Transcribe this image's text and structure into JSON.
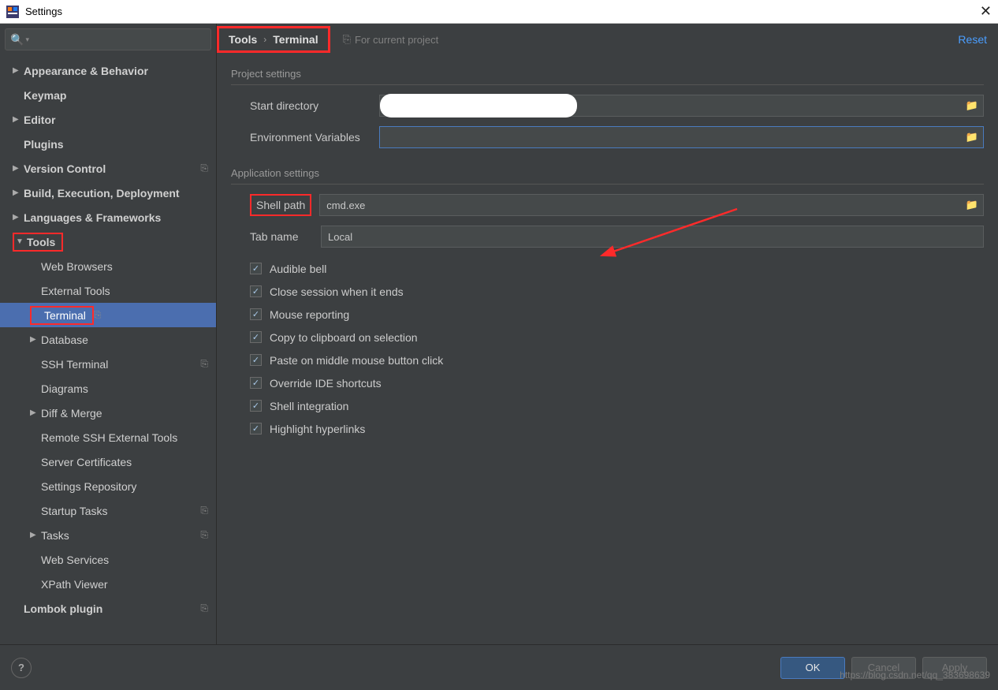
{
  "window": {
    "title": "Settings"
  },
  "breadcrumb": {
    "a": "Tools",
    "b": "Terminal",
    "hint": "For current project",
    "reset": "Reset"
  },
  "sidebar": {
    "items": [
      {
        "label": "Appearance & Behavior",
        "arrow": "▶",
        "bold": true,
        "level": 0
      },
      {
        "label": "Keymap",
        "arrow": "",
        "bold": true,
        "level": 0
      },
      {
        "label": "Editor",
        "arrow": "▶",
        "bold": true,
        "level": 0
      },
      {
        "label": "Plugins",
        "arrow": "",
        "bold": true,
        "level": 0
      },
      {
        "label": "Version Control",
        "arrow": "▶",
        "bold": true,
        "level": 0,
        "copy": true
      },
      {
        "label": "Build, Execution, Deployment",
        "arrow": "▶",
        "bold": true,
        "level": 0
      },
      {
        "label": "Languages & Frameworks",
        "arrow": "▶",
        "bold": true,
        "level": 0
      },
      {
        "label": "Tools",
        "arrow": "▼",
        "bold": true,
        "level": 0,
        "redbox": true
      },
      {
        "label": "Web Browsers",
        "arrow": "",
        "level": 1
      },
      {
        "label": "External Tools",
        "arrow": "",
        "level": 1
      },
      {
        "label": "Terminal",
        "arrow": "",
        "level": 1,
        "selected": true,
        "redbox": true,
        "copy": true
      },
      {
        "label": "Database",
        "arrow": "▶",
        "level": 1
      },
      {
        "label": "SSH Terminal",
        "arrow": "",
        "level": 1,
        "copy": true
      },
      {
        "label": "Diagrams",
        "arrow": "",
        "level": 1
      },
      {
        "label": "Diff & Merge",
        "arrow": "▶",
        "level": 1
      },
      {
        "label": "Remote SSH External Tools",
        "arrow": "",
        "level": 1
      },
      {
        "label": "Server Certificates",
        "arrow": "",
        "level": 1
      },
      {
        "label": "Settings Repository",
        "arrow": "",
        "level": 1
      },
      {
        "label": "Startup Tasks",
        "arrow": "",
        "level": 1,
        "copy": true
      },
      {
        "label": "Tasks",
        "arrow": "▶",
        "level": 1,
        "copy": true
      },
      {
        "label": "Web Services",
        "arrow": "",
        "level": 1
      },
      {
        "label": "XPath Viewer",
        "arrow": "",
        "level": 1
      },
      {
        "label": "Lombok plugin",
        "arrow": "",
        "bold": true,
        "level": 0,
        "copy": true
      }
    ]
  },
  "sections": {
    "project": "Project settings",
    "application": "Application settings"
  },
  "form": {
    "start_dir_label": "Start directory",
    "start_dir_value": "",
    "env_label": "Environment Variables",
    "env_value": "",
    "shell_label": "Shell path",
    "shell_value": "cmd.exe",
    "tab_label": "Tab name",
    "tab_value": "Local"
  },
  "checks": [
    "Audible bell",
    "Close session when it ends",
    "Mouse reporting",
    "Copy to clipboard on selection",
    "Paste on middle mouse button click",
    "Override IDE shortcuts",
    "Shell integration",
    "Highlight hyperlinks"
  ],
  "buttons": {
    "ok": "OK",
    "cancel": "Cancel",
    "apply": "Apply"
  },
  "watermark": "https://blog.csdn.net/qq_383698639"
}
